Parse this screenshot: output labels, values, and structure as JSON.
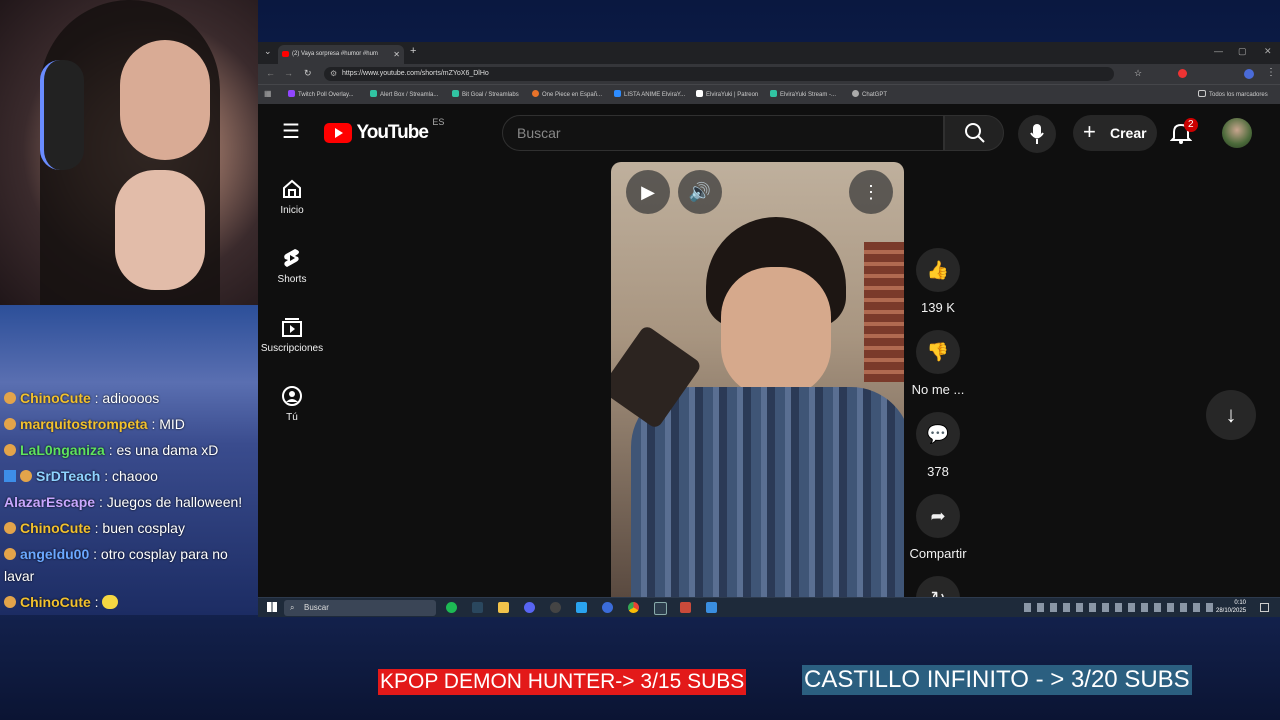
{
  "chat": {
    "messages": [
      {
        "user": "ChinoCute",
        "text": ": adioooos",
        "color": "#f2c12e"
      },
      {
        "user": "marquitostrompeta",
        "text": ": MID",
        "color": "#f2c12e"
      },
      {
        "user": "LaL0nganiza",
        "text": ": es una dama xD",
        "color": "#5ee35e"
      },
      {
        "user": "SrDTeach",
        "text": ": chaooo",
        "color": "#8fd3ff"
      },
      {
        "user": "AlazarEscape",
        "text": ": Juegos de halloween!",
        "color": "#c9a7ff"
      },
      {
        "user": "ChinoCute",
        "text": ": buen cosplay",
        "color": "#f2c12e"
      },
      {
        "user": "angeldu00",
        "text": ": otro cosplay para no",
        "color": "#6aa8ff"
      },
      {
        "user": "",
        "text": "lavar",
        "color": "#ffffff"
      },
      {
        "user": "ChinoCute",
        "text": ":",
        "color": "#f2c12e"
      }
    ]
  },
  "browser": {
    "tab_title": "(2) Vaya sorpresa #humor #hum",
    "url": "https://www.youtube.com/shorts/mZYoX6_DlHo",
    "bookmarks": [
      {
        "label": "Twitch Poll Overlay...",
        "color": "#9146ff"
      },
      {
        "label": "Alert Box / Streamla...",
        "color": "#31c3a2"
      },
      {
        "label": "Bit Goal / Streamlabs",
        "color": "#31c3a2"
      },
      {
        "label": "One Piece en Españ...",
        "color": "#e8732a"
      },
      {
        "label": "LISTA ANIME ElviraY...",
        "color": "#2d8cff"
      },
      {
        "label": "ElviraYuki | Patreon",
        "color": "#ffffff"
      },
      {
        "label": "ElviraYuki Stream -...",
        "color": "#31c3a2"
      },
      {
        "label": "ChatGPT",
        "color": "#aaaaaa"
      }
    ],
    "all_bookmarks": "Todos los marcadores"
  },
  "youtube": {
    "logo": "YouTube",
    "region": "ES",
    "search_placeholder": "Buscar",
    "create_label": "Crear",
    "notifications_count": "2",
    "nav": [
      {
        "label": "Inicio",
        "icon": "home-icon"
      },
      {
        "label": "Shorts",
        "icon": "shorts-icon"
      },
      {
        "label": "Suscripciones",
        "icon": "subscriptions-icon"
      },
      {
        "label": "Tú",
        "icon": "you-icon"
      }
    ],
    "actions": {
      "likes": "139 K",
      "dislike": "No me ...",
      "comments": "378",
      "share": "Compartir"
    }
  },
  "taskbar": {
    "search_placeholder": "Buscar",
    "time": "0:10",
    "date": "28/10/2025"
  },
  "banners": {
    "left": "KPOP DEMON HUNTER-> 3/15 SUBS",
    "right": "CASTILLO INFINITO - > 3/20 SUBS"
  }
}
